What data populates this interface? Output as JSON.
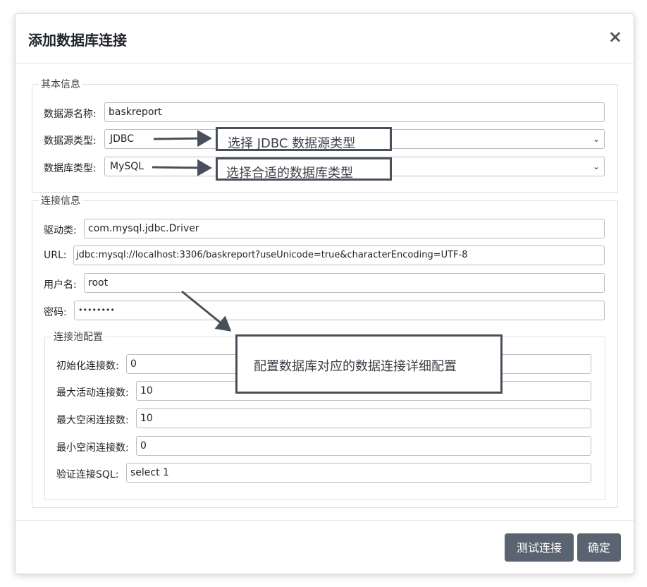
{
  "dialog": {
    "title": "添加数据库连接",
    "close_label": "×"
  },
  "basic": {
    "legend": "其本信息",
    "ds_name_label": "数据源名称:",
    "ds_name_value": "baskreport",
    "ds_type_label": "数据源类型:",
    "ds_type_value": "JDBC",
    "db_type_label": "数据库类型:",
    "db_type_value": "MySQL"
  },
  "connection": {
    "legend": "连接信息",
    "driver_label": "驱动类:",
    "driver_value": "com.mysql.jdbc.Driver",
    "url_label": "URL:",
    "url_value": "jdbc:mysql://localhost:3306/baskreport?useUnicode=true&characterEncoding=UTF-8",
    "user_label": "用户名:",
    "user_value": "root",
    "password_label": "密码:",
    "password_value": "••••••••"
  },
  "pool": {
    "legend": "连接池配置",
    "initial_label": "初始化连接数:",
    "initial_value": "0",
    "max_active_label": "最大活动连接数:",
    "max_active_value": "10",
    "max_idle_label": "最大空闲连接数:",
    "max_idle_value": "10",
    "min_idle_label": "最小空闲连接数:",
    "min_idle_value": "0",
    "validation_label": "验证连接SQL:",
    "validation_value": "select 1"
  },
  "annotations": {
    "ds_type_note": "选择 JDBC 数据源类型",
    "db_type_note": "选择合适的数据库类型",
    "pool_note": "配置数据库对应的数据连接详细配置"
  },
  "footer": {
    "test_button": "测试连接",
    "confirm_button": "确定"
  },
  "colors": {
    "button_bg": "#5a6470",
    "annotation_border": "#4a5059"
  },
  "icons": {
    "close": "close-icon",
    "dropdown": "chevron-down-icon"
  }
}
